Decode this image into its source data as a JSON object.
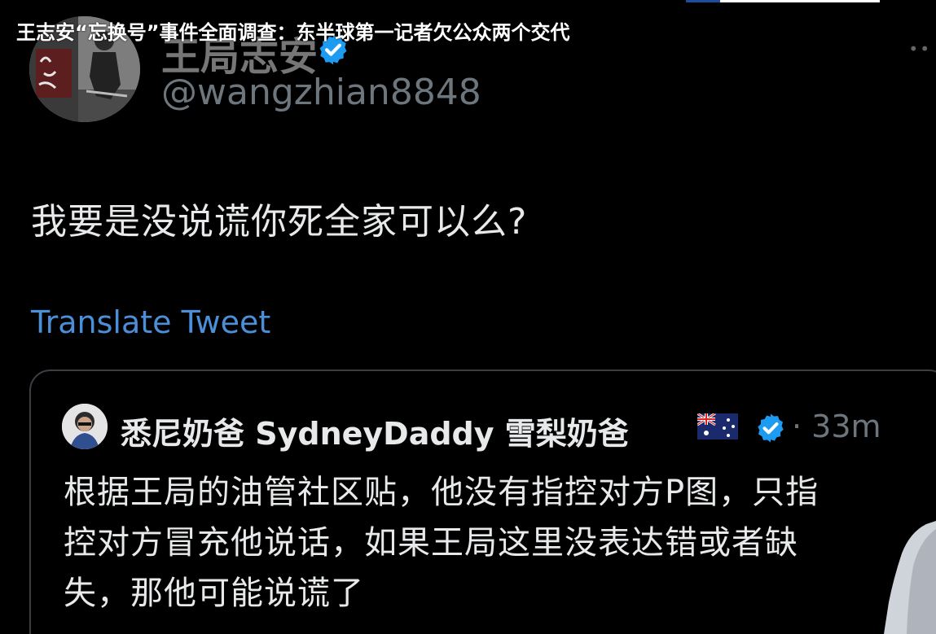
{
  "video": {
    "title": "王志安“忘换号”事件全面调查：东半球第一记者欠公众两个交代"
  },
  "tweet": {
    "display_name": "王局志安",
    "handle": "@wangzhian8848",
    "text": "我要是没说谎你死全家可以么?",
    "translate_label": "Translate Tweet",
    "verified_icon": "verified-badge-icon",
    "more_icon": "more-options-icon"
  },
  "quoted_tweet": {
    "name": "悉尼奶爸 SydneyDaddy 雪梨奶爸",
    "flag_icon": "australia-flag-icon",
    "verified_icon": "verified-badge-icon",
    "time": "· 33m",
    "text_lines": [
      "根据王局的油管社区贴，他没有指控对方P图，只指",
      "控对方冒充他说话，如果王局这里没表达错或者缺",
      "失，那他可能说谎了"
    ]
  },
  "colors": {
    "background": "#000000",
    "text_primary": "#e7e9ea",
    "text_secondary": "#6e767d",
    "link": "#4a8fd8",
    "verified": "#1d9bf0",
    "card_border": "#3a3f44"
  }
}
